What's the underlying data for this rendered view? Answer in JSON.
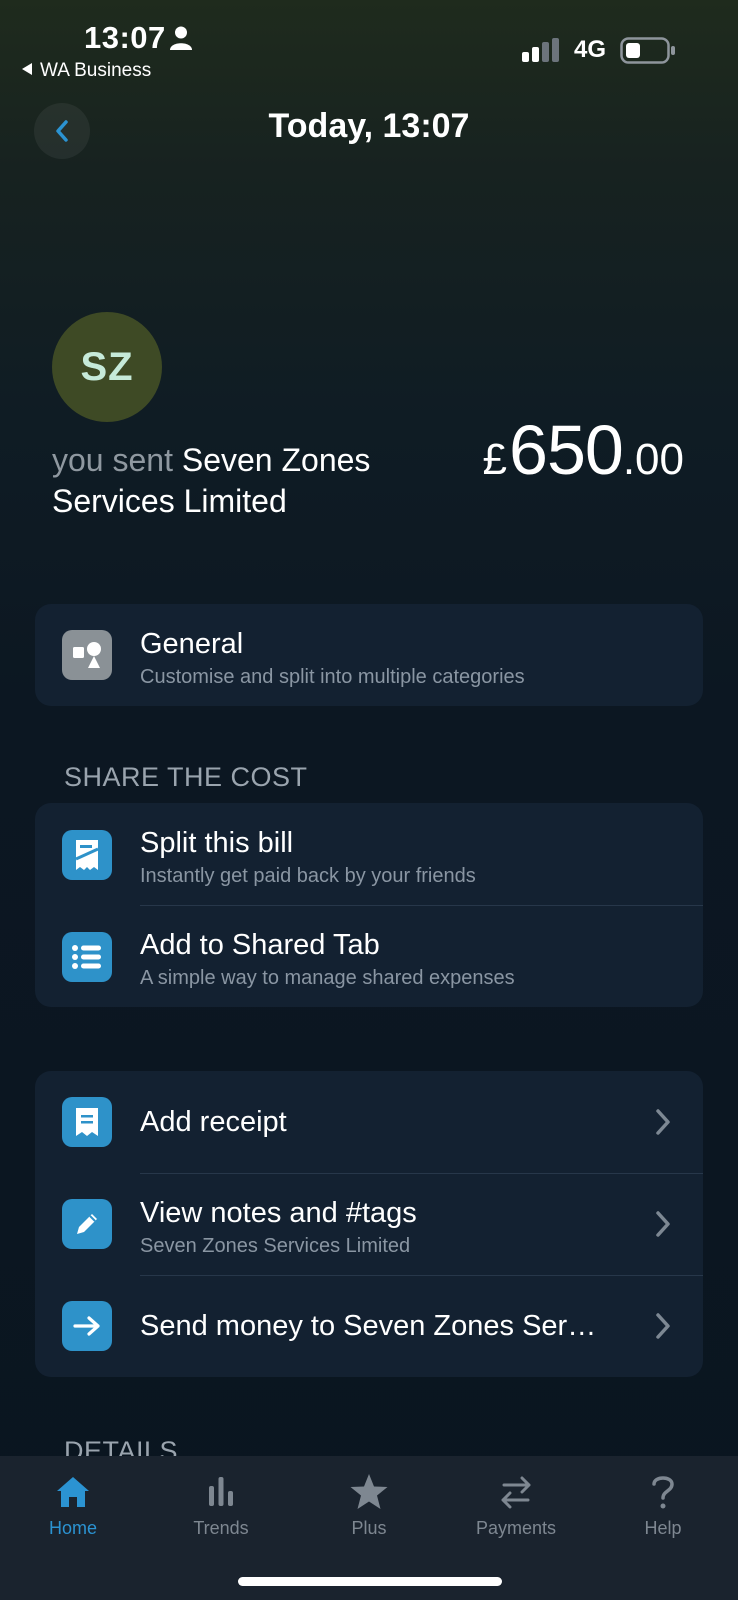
{
  "status_bar": {
    "time": "13:07",
    "back_app": "WA Business",
    "network": "4G"
  },
  "header": {
    "title": "Today, 13:07"
  },
  "transaction": {
    "avatar_initials": "SZ",
    "avatar_color": "#3e4a25",
    "prefix": "you sent",
    "payee": "Seven Zones Services Limited",
    "currency": "£",
    "amount_major": "650",
    "amount_minor": ".00"
  },
  "category": {
    "title": "General",
    "subtitle": "Customise and split into multiple categories",
    "icon": "shapes-icon"
  },
  "share_section": {
    "label": "SHARE THE COST",
    "items": [
      {
        "title": "Split this bill",
        "subtitle": "Instantly get paid back by your friends",
        "icon": "split-bill-icon"
      },
      {
        "title": "Add to Shared Tab",
        "subtitle": "A simple way to manage shared expenses",
        "icon": "list-icon"
      }
    ]
  },
  "actions": {
    "items": [
      {
        "title": "Add receipt",
        "icon": "receipt-icon"
      },
      {
        "title": "View notes and #tags",
        "subtitle": "Seven Zones Services Limited",
        "icon": "pencil-icon"
      },
      {
        "title": "Send money to Seven Zones Ser…",
        "icon": "arrow-right-icon"
      }
    ]
  },
  "details_label": "DETAILS",
  "tab_bar": {
    "items": [
      {
        "label": "Home",
        "icon": "home-icon",
        "active": true
      },
      {
        "label": "Trends",
        "icon": "bar-chart-icon",
        "active": false
      },
      {
        "label": "Plus",
        "icon": "star-icon",
        "active": false
      },
      {
        "label": "Payments",
        "icon": "transfer-arrows-icon",
        "active": false
      },
      {
        "label": "Help",
        "icon": "question-icon",
        "active": false
      }
    ]
  },
  "colors": {
    "accent": "#2b93d2",
    "card": "#132131",
    "action_icon": "#2e92c9"
  }
}
